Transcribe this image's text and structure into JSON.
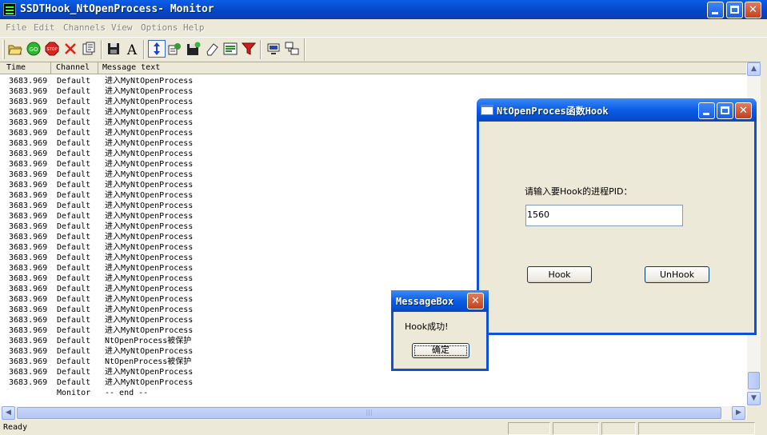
{
  "window": {
    "title": "SSDTHook_NtOpenProcess- Monitor"
  },
  "menu": [
    "File",
    "Edit",
    "Channels",
    "View",
    "Options",
    "Help"
  ],
  "toolbar_icons": [
    "open-folder-icon",
    "go-icon",
    "stop-icon",
    "clear-icon",
    "properties-icon",
    "save-icon",
    "font-icon",
    "autoscroll-icon",
    "capture-icon",
    "save-as-icon",
    "eraser-icon",
    "highlight-icon",
    "filter-icon",
    "connect-icon",
    "network-icon"
  ],
  "columns": {
    "time": "Time",
    "channel": "Channel",
    "message": "Message text"
  },
  "rows": [
    {
      "time": "3683.969",
      "channel": "Default",
      "message": "进入MyNtOpenProcess"
    },
    {
      "time": "3683.969",
      "channel": "Default",
      "message": "进入MyNtOpenProcess"
    },
    {
      "time": "3683.969",
      "channel": "Default",
      "message": "进入MyNtOpenProcess"
    },
    {
      "time": "3683.969",
      "channel": "Default",
      "message": "进入MyNtOpenProcess"
    },
    {
      "time": "3683.969",
      "channel": "Default",
      "message": "进入MyNtOpenProcess"
    },
    {
      "time": "3683.969",
      "channel": "Default",
      "message": "进入MyNtOpenProcess"
    },
    {
      "time": "3683.969",
      "channel": "Default",
      "message": "进入MyNtOpenProcess"
    },
    {
      "time": "3683.969",
      "channel": "Default",
      "message": "进入MyNtOpenProcess"
    },
    {
      "time": "3683.969",
      "channel": "Default",
      "message": "进入MyNtOpenProcess"
    },
    {
      "time": "3683.969",
      "channel": "Default",
      "message": "进入MyNtOpenProcess"
    },
    {
      "time": "3683.969",
      "channel": "Default",
      "message": "进入MyNtOpenProcess"
    },
    {
      "time": "3683.969",
      "channel": "Default",
      "message": "进入MyNtOpenProcess"
    },
    {
      "time": "3683.969",
      "channel": "Default",
      "message": "进入MyNtOpenProcess"
    },
    {
      "time": "3683.969",
      "channel": "Default",
      "message": "进入MyNtOpenProcess"
    },
    {
      "time": "3683.969",
      "channel": "Default",
      "message": "进入MyNtOpenProcess"
    },
    {
      "time": "3683.969",
      "channel": "Default",
      "message": "进入MyNtOpenProcess"
    },
    {
      "time": "3683.969",
      "channel": "Default",
      "message": "进入MyNtOpenProcess"
    },
    {
      "time": "3683.969",
      "channel": "Default",
      "message": "进入MyNtOpenProcess"
    },
    {
      "time": "3683.969",
      "channel": "Default",
      "message": "进入MyNtOpenProcess"
    },
    {
      "time": "3683.969",
      "channel": "Default",
      "message": "进入MyNtOpenProcess"
    },
    {
      "time": "3683.969",
      "channel": "Default",
      "message": "进入MyNtOpenProcess"
    },
    {
      "time": "3683.969",
      "channel": "Default",
      "message": "进入MyNtOpenProcess"
    },
    {
      "time": "3683.969",
      "channel": "Default",
      "message": "进入MyNtOpenProcess"
    },
    {
      "time": "3683.969",
      "channel": "Default",
      "message": "进入MyNtOpenProcess"
    },
    {
      "time": "3683.969",
      "channel": "Default",
      "message": "进入MyNtOpenProcess"
    },
    {
      "time": "3683.969",
      "channel": "Default",
      "message": "NtOpenProcess被保护"
    },
    {
      "time": "3683.969",
      "channel": "Default",
      "message": "进入MyNtOpenProcess"
    },
    {
      "time": "3683.969",
      "channel": "Default",
      "message": "NtOpenProcess被保护"
    },
    {
      "time": "3683.969",
      "channel": "Default",
      "message": "进入MyNtOpenProcess"
    },
    {
      "time": "3683.969",
      "channel": "Default",
      "message": "进入MyNtOpenProcess"
    },
    {
      "time": "",
      "channel": "Monitor",
      "message": "-- end --"
    }
  ],
  "status": {
    "text": "Ready"
  },
  "dialog": {
    "title": "NtOpenProces函数Hook",
    "label": "请输入要Hook的进程PID：",
    "pid_value": "1560",
    "hook_label": "Hook",
    "unhook_label": "UnHook"
  },
  "messagebox": {
    "title": "MessageBox",
    "text": "Hook成功!",
    "ok_label": "确定"
  },
  "colors": {
    "titlebar": "#0a5fe6",
    "face": "#ece9d8",
    "close": "#c4401e"
  }
}
